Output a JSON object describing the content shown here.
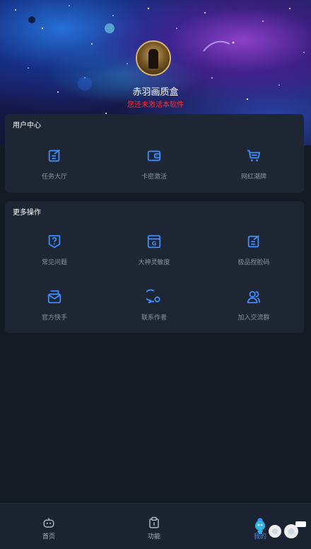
{
  "header": {
    "app_name": "赤羽画质盒",
    "status_text": "您还未激活本软件"
  },
  "user_center": {
    "title": "用户中心",
    "items": [
      {
        "label": "任务大厅",
        "icon": "task-icon"
      },
      {
        "label": "卡密激活",
        "icon": "wallet-icon"
      },
      {
        "label": "网红潮牌",
        "icon": "cart-icon"
      }
    ]
  },
  "more_actions": {
    "title": "更多操作",
    "items": [
      {
        "label": "常见问题",
        "icon": "help-shield-icon"
      },
      {
        "label": "大神灵敏度",
        "icon": "g-window-icon"
      },
      {
        "label": "极品捏脸码",
        "icon": "edit-note-icon"
      },
      {
        "label": "官方快手",
        "icon": "mail-icon"
      },
      {
        "label": "联系作者",
        "icon": "chat-icon"
      },
      {
        "label": "加入交流群",
        "icon": "group-icon"
      }
    ]
  },
  "bottom_nav": {
    "items": [
      {
        "label": "首页",
        "icon": "robot-icon"
      },
      {
        "label": "功能",
        "icon": "clipboard-icon"
      },
      {
        "label": "我的",
        "icon": "user-icon"
      }
    ]
  },
  "colors": {
    "background": "#151b25",
    "card": "#1f2633",
    "accent": "#3d8bff",
    "status_red": "#ff2f2f"
  }
}
